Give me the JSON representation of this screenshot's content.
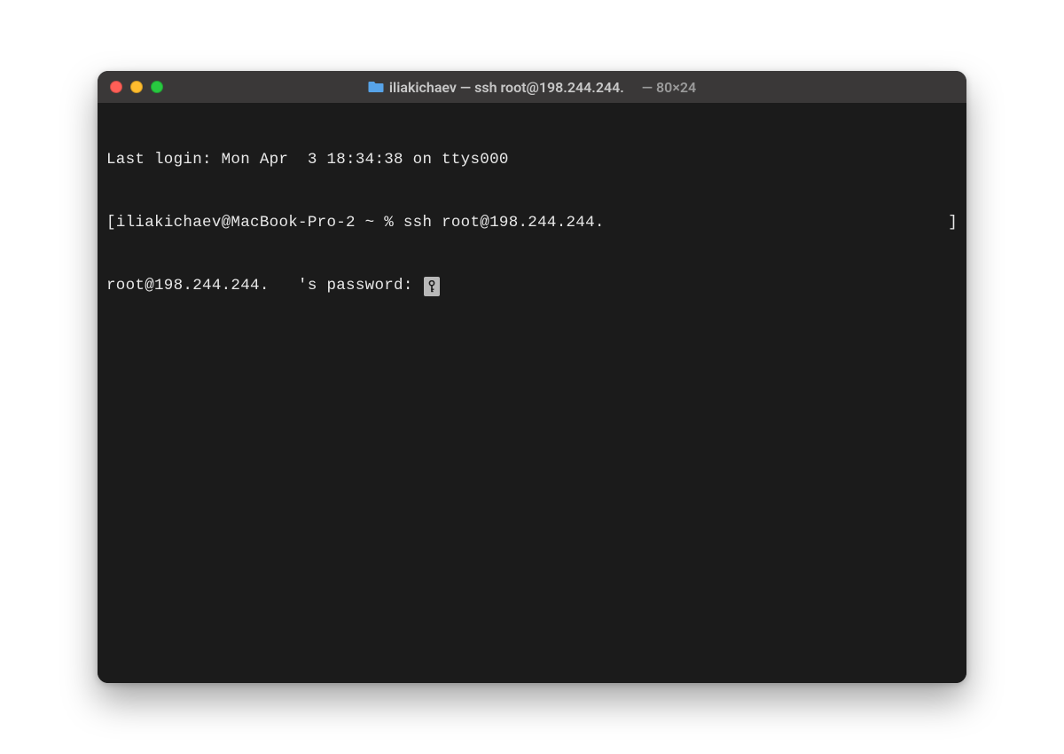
{
  "titlebar": {
    "folder_icon": "folder-icon",
    "title_main": "iliakichaev — ssh root@198.244.244.",
    "title_dim": "— 80×24"
  },
  "terminal": {
    "line1": "Last login: Mon Apr  3 18:34:38 on ttys000",
    "prompt_open": "[",
    "prompt_user_host": "iliakichaev@MacBook-Pro-2 ~ % ",
    "prompt_command": "ssh root@198.244.244.",
    "prompt_close": "]",
    "password_prompt": "root@198.244.244.   's password: "
  }
}
